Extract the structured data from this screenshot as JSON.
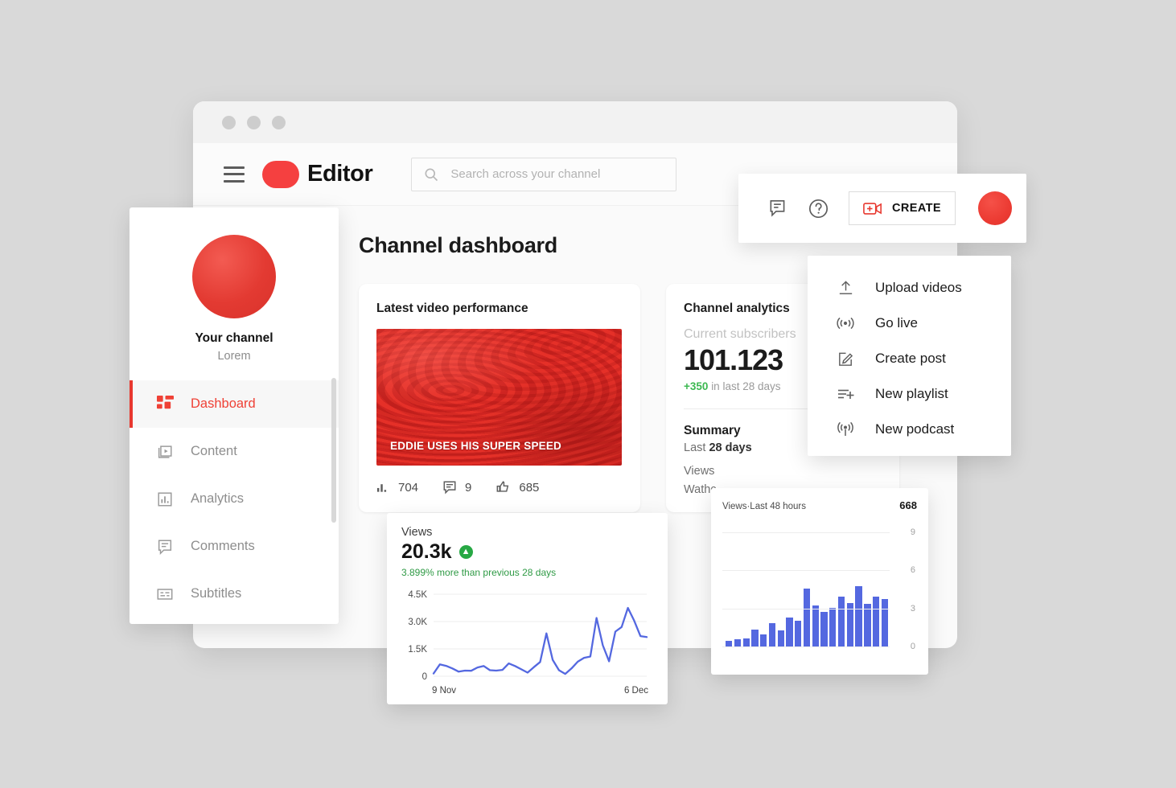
{
  "window": {
    "traffic_lights": 3
  },
  "topbar": {
    "menu_icon": "hamburger-icon",
    "brand": "Editor",
    "search_placeholder": "Search across your channel",
    "search_icon": "search-icon"
  },
  "createbar": {
    "feedback_icon": "feedback-icon",
    "help_icon": "help-circle-icon",
    "create_icon": "create-video-icon",
    "create_label": "CREATE",
    "avatar": "user-avatar"
  },
  "create_menu": {
    "items": [
      {
        "label": "Upload videos",
        "icon": "upload-icon"
      },
      {
        "label": "Go live",
        "icon": "broadcast-icon"
      },
      {
        "label": "Create post",
        "icon": "edit-square-icon"
      },
      {
        "label": "New playlist",
        "icon": "playlist-add-icon"
      },
      {
        "label": "New podcast",
        "icon": "podcast-icon"
      }
    ]
  },
  "sidebar": {
    "channel_name": "Your channel",
    "channel_sub": "Lorem",
    "avatar": "channel-avatar",
    "items": [
      {
        "label": "Dashboard",
        "icon": "dashboard-grid-icon",
        "active": true
      },
      {
        "label": "Content",
        "icon": "content-play-icon",
        "active": false
      },
      {
        "label": "Analytics",
        "icon": "analytics-bar-icon",
        "active": false
      },
      {
        "label": "Comments",
        "icon": "comment-icon",
        "active": false
      },
      {
        "label": "Subtitles",
        "icon": "subtitles-icon",
        "active": false
      }
    ]
  },
  "main": {
    "page_title": "Channel dashboard",
    "latest_video": {
      "heading": "Latest video performance",
      "thumb_title": "EDDIE USES HIS SUPER SPEED",
      "stats": [
        {
          "icon": "views-bar-icon",
          "value": "704"
        },
        {
          "icon": "comment-icon",
          "value": "9"
        },
        {
          "icon": "thumbs-up-icon",
          "value": "685"
        }
      ]
    },
    "analytics": {
      "heading": "Channel analytics",
      "subs_label": "Current subscribers",
      "subs_value": "101.123",
      "delta_value": "+350",
      "delta_suffix": "in last 28 days",
      "summary_heading": "Summary",
      "summary_period_prefix": "Last ",
      "summary_period_value": "28 days",
      "rows": [
        "Views",
        "Wathc"
      ]
    }
  },
  "views_card": {
    "label": "Views",
    "value": "20.3k",
    "trend_icon": "arrow-up-circle-icon",
    "note": "3.899% more than previous 28 days"
  },
  "bars_card": {
    "title": "Views·Last 48 hours",
    "total": "668"
  },
  "colors": {
    "brand_red": "#ef4136",
    "chart_blue": "#5468e0",
    "positive_green": "#2f9a45",
    "page_bg": "#d9d9d9"
  },
  "chart_data": [
    {
      "type": "line",
      "title": "Views",
      "xlabel": "",
      "ylabel": "",
      "ylim": [
        0,
        4500
      ],
      "yticks": [
        0,
        1500,
        3000,
        4500
      ],
      "ytick_labels": [
        "0",
        "1.5K",
        "3.0K",
        "4.5K"
      ],
      "xticks": [
        "9 Nov",
        "6 Dec"
      ],
      "grid": true,
      "legend": "none",
      "series": [
        {
          "name": "Views",
          "color": "#5468e0",
          "values": [
            150,
            650,
            570,
            430,
            250,
            310,
            300,
            480,
            560,
            330,
            310,
            350,
            700,
            560,
            380,
            200,
            500,
            780,
            2350,
            900,
            330,
            130,
            430,
            800,
            1010,
            1080,
            3200,
            1700,
            820,
            2450,
            2700,
            3750,
            3050,
            2200,
            2150
          ]
        }
      ]
    },
    {
      "type": "bar",
      "title": "Views·Last 48 hours",
      "annotation_total": "668",
      "ylim": [
        0,
        10
      ],
      "yticks": [
        0,
        3,
        6,
        9
      ],
      "ytick_labels": [
        "0",
        "3",
        "6",
        "9"
      ],
      "grid": true,
      "categories": [
        "h1",
        "h2",
        "h3",
        "h4",
        "h5",
        "h6",
        "h7",
        "h8",
        "h9",
        "h10",
        "h11",
        "h12",
        "h13",
        "h14",
        "h15",
        "h16",
        "h17",
        "h18"
      ],
      "values": [
        0.45,
        0.55,
        0.65,
        1.35,
        0.95,
        1.85,
        1.25,
        2.25,
        2.05,
        4.55,
        3.25,
        2.75,
        3.05,
        3.95,
        3.45,
        4.75,
        3.35,
        3.95,
        3.75
      ],
      "color": "#5468e0"
    }
  ]
}
